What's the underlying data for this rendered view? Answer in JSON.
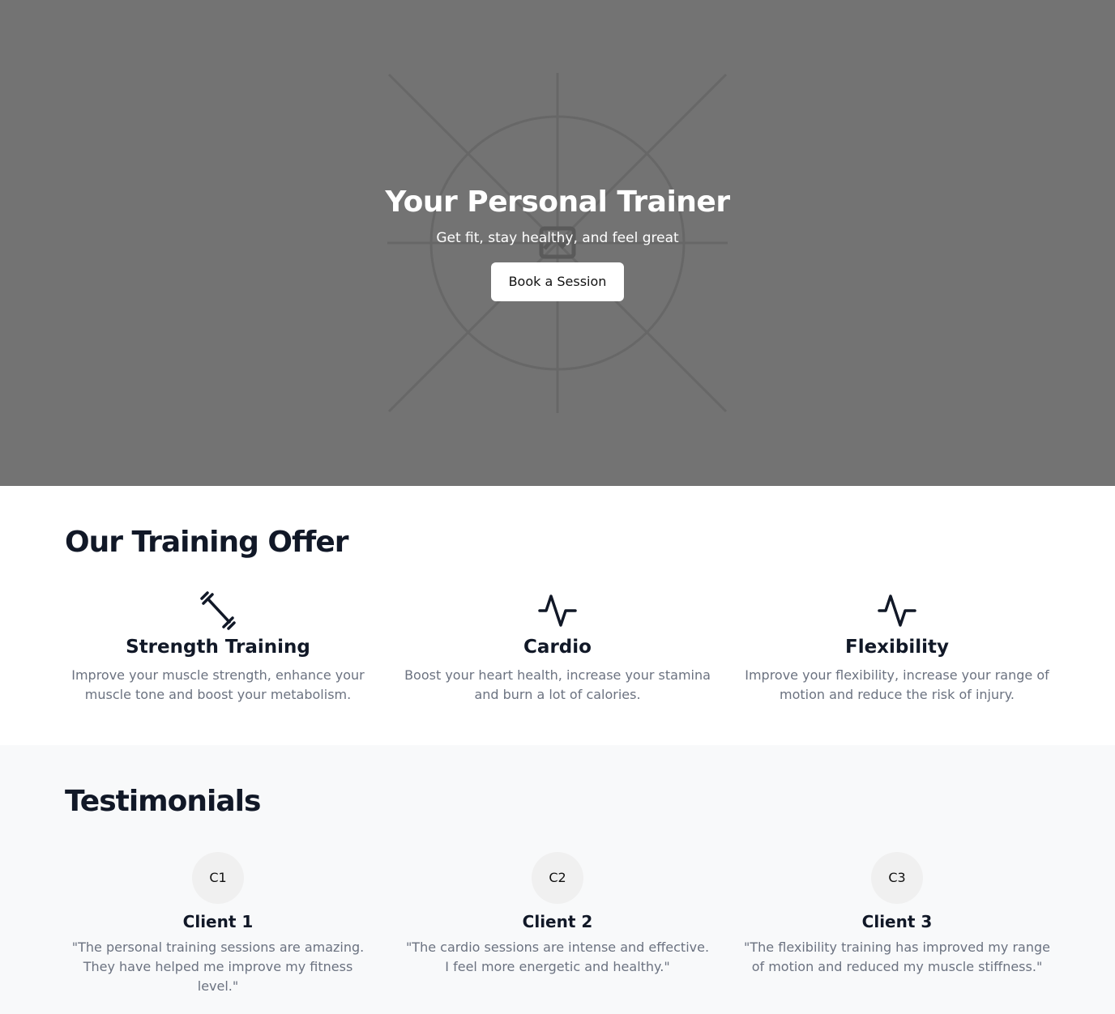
{
  "hero": {
    "title": "Your Personal Trainer",
    "subtitle": "Get fit, stay healthy, and feel great",
    "button_label": "Book a Session",
    "background_color": "#737373",
    "placeholder_icon": "image-placeholder-icon"
  },
  "offers": {
    "title": "Our Training Offer",
    "items": [
      {
        "icon": "dumbbell-icon",
        "title": "Strength Training",
        "text": "Improve your muscle strength, enhance your muscle tone and boost your metabolism."
      },
      {
        "icon": "activity-icon",
        "title": "Cardio",
        "text": "Boost your heart health, increase your stamina and burn a lot of calories."
      },
      {
        "icon": "activity-icon",
        "title": "Flexibility",
        "text": "Improve your flexibility, increase your range of motion and reduce the risk of injury."
      }
    ]
  },
  "testimonials": {
    "title": "Testimonials",
    "items": [
      {
        "avatar": "C1",
        "name": "Client 1",
        "quote": "\"The personal training sessions are amazing. They have helped me improve my fitness level.\""
      },
      {
        "avatar": "C2",
        "name": "Client 2",
        "quote": "\"The cardio sessions are intense and effective. I feel more energetic and healthy.\""
      },
      {
        "avatar": "C3",
        "name": "Client 3",
        "quote": "\"The flexibility training has improved my range of motion and reduced my muscle stiffness.\""
      }
    ]
  },
  "colors": {
    "heading": "#111827",
    "muted_text": "#6b7280",
    "testimonials_bg": "#f8f9fa"
  }
}
